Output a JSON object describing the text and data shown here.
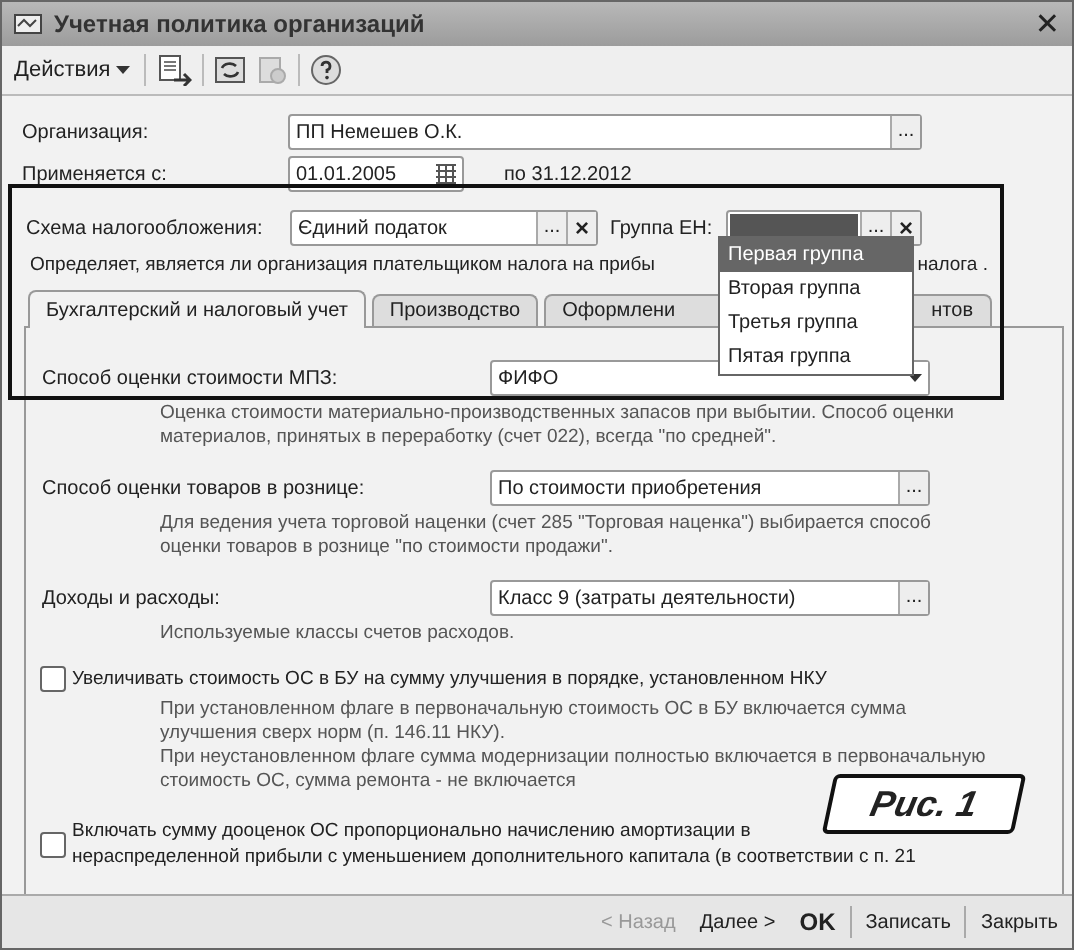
{
  "window": {
    "title": "Учетная политика организаций",
    "close": "✕"
  },
  "toolbar": {
    "actions_menu": "Действия"
  },
  "organization": {
    "label": "Организация:",
    "value": "ПП Немешев О.К.",
    "button": "..."
  },
  "applies": {
    "label": "Применяется с:",
    "value": "01.01.2005",
    "until": "по 31.12.2012"
  },
  "tax_scheme": {
    "label": "Схема налогообложения:",
    "value": "Єдиний податок",
    "button": "...",
    "clear": "×"
  },
  "single_tax_group": {
    "label": "Группа ЕН:",
    "button": "...",
    "clear": "×",
    "focused": true
  },
  "tax_scheme_hint": {
    "text": "Определяет, является ли организация плательщиком налога на прибы",
    "tail": "налога ."
  },
  "group_dropdown": [
    {
      "label": "Первая группа",
      "selected": true
    },
    {
      "label": "Вторая группа",
      "selected": false
    },
    {
      "label": "Третья группа",
      "selected": false
    },
    {
      "label": "Пятая группа",
      "selected": false
    }
  ],
  "tabs": [
    {
      "label": "Бухгалтерский  и налоговый учет",
      "selected": true
    },
    {
      "label": "Производство",
      "selected": false
    },
    {
      "label": "Оформлени",
      "tail": "нтов",
      "selected": false
    }
  ],
  "settings": [
    {
      "kind": "select",
      "label": "Способ оценки стоимости МПЗ:",
      "value": "ФИФО",
      "hint": [
        "Оценка стоимости материально-производственных запасов при выбытии. Способ оценки",
        "материалов, принятых в переработку (счет 022), всегда \"по средней\"."
      ]
    },
    {
      "kind": "choice",
      "label": "Способ оценки товаров в рознице:",
      "value": "По стоимости приобретения",
      "button": "...",
      "hint": [
        "Для ведения учета торговой наценки (счет 285 \"Торговая наценка\") выбирается способ",
        "оценки товаров в рознице \"по стоимости продажи\"."
      ]
    },
    {
      "kind": "choice",
      "label": "Доходы и расходы:",
      "value": "Класс 9 (затраты деятельности)",
      "button": "...",
      "hint": [
        "Используемые классы счетов расходов."
      ]
    },
    {
      "kind": "checkbox",
      "label": "Увеличивать стоимость ОС в БУ на сумму улучшения в порядке, установленном НКУ",
      "checked": false,
      "hint": [
        "При установленном флаге в первоначальную стоимость ОС в БУ включается сумма",
        "улучшения сверх норм (п. 146.11 НКУ).",
        "При неустановленном флаге сумма модернизации полностью включается в первоначальную",
        "стоимость ОС, сумма ремонта - не включается"
      ]
    },
    {
      "kind": "checkbox",
      "label": "Включать сумму дооценок ОС пропорционально начислению амортизации в",
      "label_line_2": "нераспределенной прибыли с уменьшением дополнительного капитала (в соответствии с п. 21",
      "checked": false
    }
  ],
  "buttons": [
    {
      "label": "< Назад",
      "disabled": true,
      "default": false
    },
    {
      "label": "Далее >",
      "disabled": false,
      "default": false
    },
    {
      "label": "OK",
      "disabled": false,
      "default": true
    },
    {
      "label": "Записать",
      "disabled": false,
      "default": false
    },
    {
      "label": "Закрыть",
      "disabled": false,
      "default": false
    }
  ],
  "caption": "Рис. 1"
}
